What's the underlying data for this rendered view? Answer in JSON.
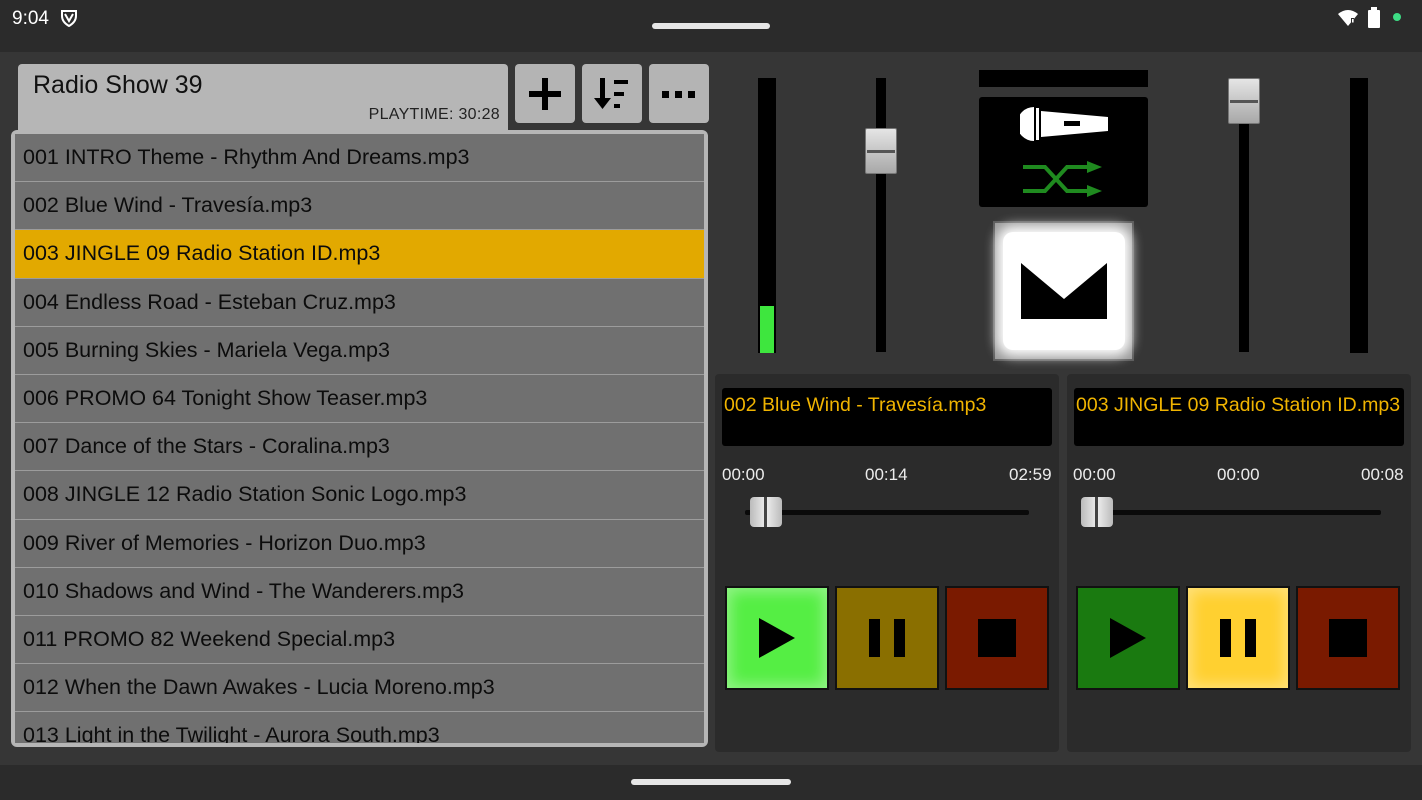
{
  "status": {
    "time": "9:04"
  },
  "playlist": {
    "title": "Radio Show 39",
    "playtime": "PLAYTIME: 30:28",
    "items": [
      "001 INTRO Theme - Rhythm And Dreams.mp3",
      "002 Blue Wind - Travesía.mp3",
      "003 JINGLE 09 Radio Station ID.mp3",
      "004 Endless Road - Esteban Cruz.mp3",
      "005 Burning Skies - Mariela Vega.mp3",
      "006 PROMO 64 Tonight Show Teaser.mp3",
      "007 Dance of the Stars - Coralina.mp3",
      "008 JINGLE 12 Radio Station Sonic Logo.mp3",
      "009 River of Memories - Horizon Duo.mp3",
      "010 Shadows and Wind - The Wanderers.mp3",
      "011 PROMO 82 Weekend Special.mp3",
      "012 When the Dawn Awakes - Lucia Moreno.mp3",
      "013 Light in the Twilight - Aurora South.mp3"
    ],
    "selected_index": 2
  },
  "toolbar": {
    "add_icon": "plus-icon",
    "sort_icon": "sort-icon",
    "more_icon": "more-icon"
  },
  "mixer": {
    "left_meter_level": 0.17,
    "left_fader_level": 0.78,
    "right_fader_level": 1.0,
    "right_meter_level": 0.0,
    "mic_icon": "microphone-icon",
    "shuffle_icon": "shuffle-icon",
    "mail_icon": "mail-icon",
    "shuffle_color": "#1f8a1f",
    "meter_color": "#3ee63e"
  },
  "deck_a": {
    "title": "002 Blue Wind - Travesía.mp3",
    "time_start": "00:00",
    "time_current": "00:14",
    "time_end": "02:59",
    "play_active": true,
    "pause_active": false,
    "colors": {
      "play": "#55ee44",
      "pause": "#8a6f00",
      "stop": "#7a1a00"
    }
  },
  "deck_b": {
    "title": "003 JINGLE 09 Radio Station ID.mp3",
    "time_start": "00:00",
    "time_current": "00:00",
    "time_end": "00:08",
    "play_active": false,
    "pause_active": true,
    "colors": {
      "play": "#1a7a10",
      "pause": "#ffd030",
      "stop": "#7a1a00"
    }
  }
}
